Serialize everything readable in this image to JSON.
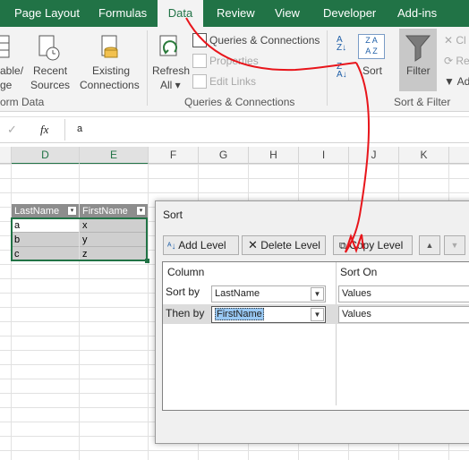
{
  "tabs": [
    "Page Layout",
    "Formulas",
    "Data",
    "Review",
    "View",
    "Developer",
    "Add-ins"
  ],
  "ribbon": {
    "get_transform": {
      "item1": "able/",
      "item1b": "ge",
      "item2": "Recent",
      "item2b": "Sources",
      "item3": "Existing",
      "item3b": "Connections",
      "group_label": "orm Data"
    },
    "queries": {
      "refresh": "Refresh",
      "refresh_b": "All",
      "queries_connections": "Queries & Connections",
      "properties": "Properties",
      "edit_links": "Edit Links",
      "group_label": "Queries & Connections"
    },
    "sort_filter": {
      "sort": "Sort",
      "filter": "Filter",
      "clear": "Cl",
      "reapply": "Re",
      "advanced": "Ad",
      "group_label": "Sort & Filter"
    }
  },
  "formula_bar": {
    "fx": "fx",
    "value": "a"
  },
  "columns": [
    "D",
    "E",
    "F",
    "G",
    "H",
    "I",
    "J",
    "K"
  ],
  "table": {
    "headers": [
      "LastName",
      "FirstName"
    ],
    "rows": [
      [
        "a",
        "x"
      ],
      [
        "b",
        "y"
      ],
      [
        "c",
        "z"
      ]
    ]
  },
  "sort_dialog": {
    "title": "Sort",
    "add_level": "Add Level",
    "delete_level": "Delete Level",
    "copy_level": "Copy Level",
    "column_header": "Column",
    "sort_on_header": "Sort On",
    "rows": [
      {
        "label": "Sort by",
        "column": "LastName",
        "sort_on": "Values"
      },
      {
        "label": "Then by",
        "column": "FirstName",
        "sort_on": "Values"
      }
    ]
  },
  "colors": {
    "excel_green": "#217346",
    "annotation": "#e8151b",
    "selection": "#99c9f4"
  }
}
